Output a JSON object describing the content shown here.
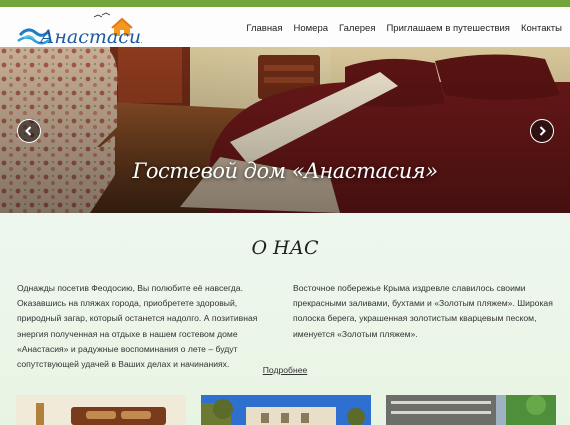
{
  "brand": {
    "logo_text": "Анастасия"
  },
  "nav": {
    "items": [
      "Главная",
      "Номера",
      "Галерея",
      "Приглашаем в путешествия",
      "Контакты"
    ]
  },
  "hero": {
    "caption": "Гостевой дом «Анастасия»"
  },
  "about": {
    "title": "О НАС",
    "col_left": "Однажды посетив Феодосию, Вы полюбите её навсегда. Оказавшись на пляжах города, приобретете здоровый, природный загар, который останется надолго. А позитивная энергия полученная на отдыхе в нашем гостевом доме «Анастасия» и радужные воспоминания о лете – будут сопутствующей удачей в Ваших делах и начинаниях.",
    "col_right": "Восточное побережье Крыма издревле славилось своими прекрасными заливами, бухтами и «Золотым пляжем». Широкая полоска берега, украшенная золотистым кварцевым песком, именуется «Золотым пляжем».",
    "more_link": "Подробнее"
  },
  "colors": {
    "accent": "#74a53a",
    "header_bg": "#fdfdfd",
    "page_bg": "#eef6ec"
  }
}
